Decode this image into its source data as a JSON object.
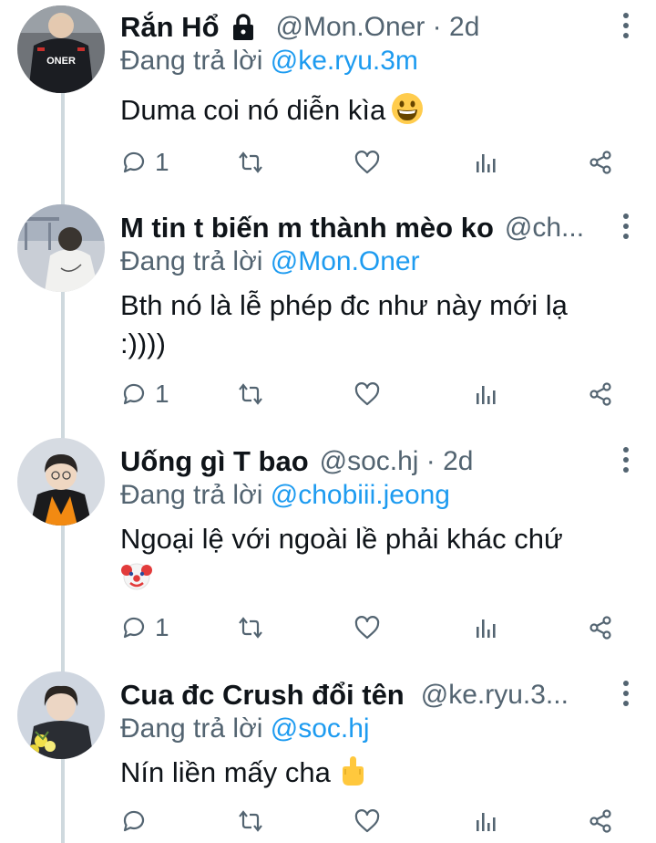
{
  "replies": [
    {
      "name": "Rắn Hổ",
      "protected": true,
      "handle": "@Mon.Oner · 2d",
      "reply_prefix": "Đang trả lời",
      "reply_to": "@ke.ryu.3m",
      "text": "Duma coi nó diễn kìa",
      "emoji": "grinning-face",
      "reply_count": "1",
      "avatar": "jersey-oner"
    },
    {
      "name": "M tin t biến m thành mèo ko",
      "protected": false,
      "handle": "@ch...",
      "reply_prefix": "Đang trả lời",
      "reply_to": "@Mon.Oner",
      "text": "Bth nó là lễ phép đc như này mới lạ :))))",
      "emoji": "",
      "reply_count": "1",
      "avatar": "person-white-shirt"
    },
    {
      "name": "Uống gì T bao",
      "protected": false,
      "handle": "@soc.hj · 2d",
      "reply_prefix": "Đang trả lời",
      "reply_to": "@chobiii.jeong",
      "text": "Ngoại lệ với ngoài lề phải khác chứ",
      "emoji": "clown-face",
      "reply_count": "1",
      "avatar": "graduate"
    },
    {
      "name": "Cua đc Crush đổi tên",
      "protected": false,
      "handle": "@ke.ryu.3...",
      "reply_prefix": "Đang trả lời",
      "reply_to": "@soc.hj",
      "text": "Nín liền mấy cha",
      "emoji": "middle-finger",
      "reply_count": "",
      "avatar": "person-flowers"
    }
  ],
  "icons": {
    "reply": "reply-icon",
    "retweet": "retweet-icon",
    "like": "heart-icon",
    "views": "views-icon",
    "share": "share-icon",
    "more": "more-icon",
    "lock": "lock-icon"
  },
  "colors": {
    "text": "#0f1419",
    "secondary": "#536471",
    "mention": "#1d9bf0",
    "thread_line": "#cfd9de"
  }
}
